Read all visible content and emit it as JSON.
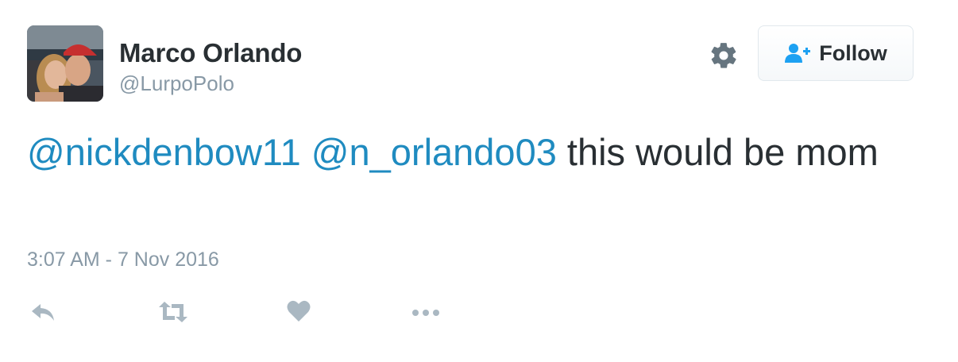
{
  "user": {
    "name": "Marco Orlando",
    "handle": "@LurpoPolo"
  },
  "follow_button": {
    "label": "Follow",
    "icon": "follow-person-plus-icon"
  },
  "settings_icon": "gear-icon",
  "tweet": {
    "mentions": [
      "@nickdenbow11",
      "@n_orlando03"
    ],
    "text": "this would be mom",
    "timestamp": "3:07 AM - 7 Nov 2016"
  },
  "actions": [
    "reply-icon",
    "retweet-icon",
    "like-heart-icon",
    "more-dots-icon"
  ],
  "colors": {
    "link": "#1f8bc0",
    "muted": "#8899a6",
    "text": "#292f33",
    "follow_icon": "#1da1f2"
  }
}
